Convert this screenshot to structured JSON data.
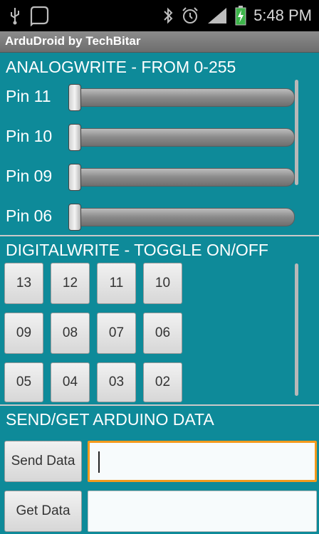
{
  "status_bar": {
    "time": "5:48 PM",
    "icons": [
      "usb-icon",
      "chat-bubble-icon",
      "bluetooth-icon",
      "alarm-icon",
      "signal-icon",
      "battery-charging-icon"
    ]
  },
  "app": {
    "title": "ArduDroid by TechBitar"
  },
  "analog": {
    "title": "ANALOGWRITE - FROM 0-255",
    "pins": [
      {
        "label": "Pin 11",
        "value": 0
      },
      {
        "label": "Pin 10",
        "value": 0
      },
      {
        "label": "Pin 09",
        "value": 0
      },
      {
        "label": "Pin 06",
        "value": 0
      }
    ]
  },
  "digital": {
    "title": "DIGITALWRITE - TOGGLE ON/OFF",
    "buttons": [
      "13",
      "12",
      "11",
      "10",
      "09",
      "08",
      "07",
      "06",
      "05",
      "04",
      "03",
      "02"
    ]
  },
  "data": {
    "title": "SEND/GET ARDUINO DATA",
    "send_label": "Send Data",
    "get_label": "Get Data",
    "send_value": "",
    "get_value": ""
  },
  "colors": {
    "background": "#0e8a99",
    "focus": "#f39a1d"
  }
}
